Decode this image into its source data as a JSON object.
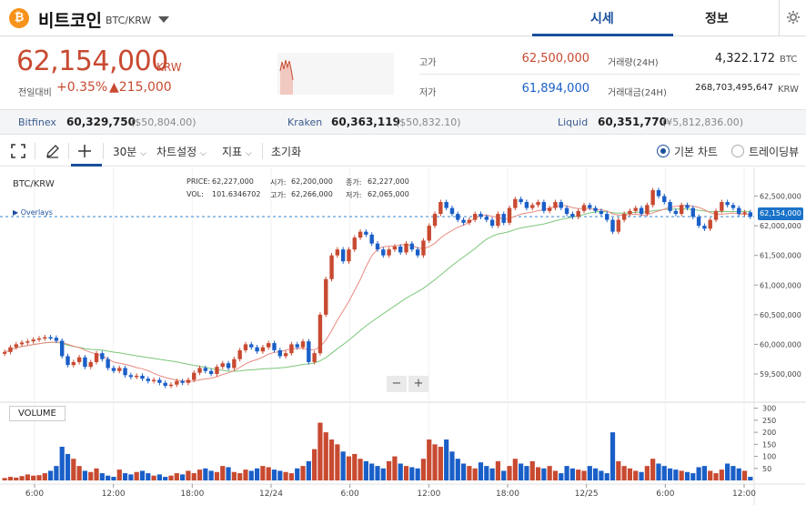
{
  "header": {
    "coin_icon_glyph": "₿",
    "coin_name": "비트코인",
    "pair": "BTC/KRW",
    "tabs": [
      "시세",
      "정보"
    ]
  },
  "ticker": {
    "price": "62,154,000",
    "price_unit": "KRW",
    "change_label": "전일대비",
    "change_pct": "+0.35%",
    "change_amount": "▲215,000",
    "high_label": "고가",
    "high_value": "62,500,000",
    "low_label": "저가",
    "low_value": "61,894,000",
    "volume_label": "거래량(24H)",
    "volume_value": "4,322.172",
    "volume_unit": "BTC",
    "amount_label": "거래대금(24H)",
    "amount_value": "268,703,495,647",
    "amount_unit": "KRW"
  },
  "exchanges": [
    {
      "name": "Bitfinex",
      "price": "60,329,750",
      "usd": "($50,804.00)"
    },
    {
      "name": "Kraken",
      "price": "60,363,119",
      "usd": "($50,832.10)"
    },
    {
      "name": "Liquid",
      "price": "60,351,770",
      "usd": "(¥5,812,836.00)"
    }
  ],
  "toolbar": {
    "interval": "30분",
    "chart_settings": "차트설정",
    "indicators": "지표",
    "reset": "초기화",
    "basic_chart": "기본 차트",
    "tradingview": "트레이딩뷰"
  },
  "chart_legend": {
    "pair": "BTC/KRW",
    "price_label": "PRICE:",
    "price_value": "62,227,000",
    "vol_label": "VOL:",
    "vol_value": "101.6346702",
    "open_label": "시가:",
    "open_value": "62,200,000",
    "close_label": "종가:",
    "close_value": "62,227,000",
    "high_label": "고가:",
    "high_value": "62,266,000",
    "low_label": "저가:",
    "low_value": "62,065,000",
    "overlays": "Overlays",
    "current_price_tag": "62,154,000",
    "volume_button": "VOLUME",
    "zoom_out": "−",
    "zoom_in": "+"
  },
  "colors": {
    "up": "#c84a31",
    "down": "#1a5fc8",
    "accent": "#1a4f9c",
    "ma_short": "#e88a80",
    "ma_long": "#7cc77a"
  },
  "chart_data": {
    "type": "candlestick",
    "x_tick_labels": [
      "6:00",
      "12:00",
      "18:00",
      "12/24",
      "6:00",
      "12:00",
      "18:00",
      "12/25",
      "6:00",
      "12:00"
    ],
    "y_tick_labels": [
      "62,500,000",
      "62,000,000",
      "61,500,000",
      "61,000,000",
      "60,500,000",
      "60,000,000",
      "59,500,000"
    ],
    "ylim": [
      59300000,
      62800000
    ],
    "volume_tick_labels": [
      "300",
      "250",
      "200",
      "150",
      "100",
      "50"
    ],
    "volume_ylim": [
      0,
      310
    ],
    "close": [
      59870000,
      59950000,
      60000000,
      60030000,
      60050000,
      60080000,
      60100000,
      60120000,
      60110000,
      60060000,
      59800000,
      59650000,
      59700000,
      59780000,
      59620000,
      59700000,
      59850000,
      59750000,
      59600000,
      59550000,
      59600000,
      59480000,
      59450000,
      59470000,
      59420000,
      59380000,
      59400000,
      59350000,
      59300000,
      59320000,
      59380000,
      59350000,
      59400000,
      59520000,
      59600000,
      59550000,
      59500000,
      59620000,
      59680000,
      59600000,
      59750000,
      59900000,
      60000000,
      59950000,
      59880000,
      59950000,
      60020000,
      59900000,
      59800000,
      59850000,
      60000000,
      59950000,
      60050000,
      59700000,
      59850000,
      60500000,
      61100000,
      61500000,
      61600000,
      61400000,
      61600000,
      61800000,
      61900000,
      61850000,
      61700000,
      61600000,
      61500000,
      61600000,
      61650000,
      61550000,
      61700000,
      61600000,
      61500000,
      61750000,
      62000000,
      62200000,
      62400000,
      62300000,
      62200000,
      62100000,
      62050000,
      62100000,
      62200000,
      62150000,
      62100000,
      62000000,
      62200000,
      62050000,
      62300000,
      62450000,
      62400000,
      62300000,
      62350000,
      62400000,
      62250000,
      62300000,
      62400000,
      62300000,
      62200000,
      62150000,
      62250000,
      62350000,
      62300000,
      62250000,
      62200000,
      62100000,
      61900000,
      62100000,
      62200000,
      62250000,
      62300000,
      62200000,
      62350000,
      62600000,
      62500000,
      62400000,
      62250000,
      62200000,
      62350000,
      62300000,
      62150000,
      62000000,
      61950000,
      62100000,
      62250000,
      62400000,
      62350000,
      62300000,
      62200000,
      62227000,
      62154000
    ],
    "volume": [
      10,
      15,
      12,
      18,
      25,
      20,
      22,
      30,
      40,
      60,
      140,
      110,
      90,
      60,
      40,
      35,
      50,
      30,
      20,
      15,
      45,
      30,
      25,
      35,
      40,
      30,
      20,
      25,
      15,
      20,
      30,
      25,
      40,
      30,
      45,
      50,
      40,
      35,
      60,
      55,
      35,
      30,
      45,
      40,
      50,
      60,
      55,
      45,
      40,
      35,
      30,
      50,
      60,
      80,
      130,
      240,
      200,
      170,
      150,
      120,
      100,
      110,
      90,
      80,
      70,
      60,
      50,
      80,
      100,
      70,
      60,
      55,
      50,
      90,
      170,
      150,
      140,
      170,
      120,
      90,
      70,
      60,
      50,
      75,
      60,
      50,
      80,
      40,
      60,
      90,
      70,
      60,
      80,
      55,
      50,
      60,
      40,
      30,
      60,
      50,
      45,
      40,
      60,
      50,
      40,
      30,
      200,
      80,
      60,
      50,
      40,
      35,
      60,
      90,
      70,
      60,
      50,
      45,
      40,
      35,
      30,
      55,
      60,
      40,
      30,
      45,
      70,
      60,
      50,
      40,
      15,
      10
    ]
  }
}
